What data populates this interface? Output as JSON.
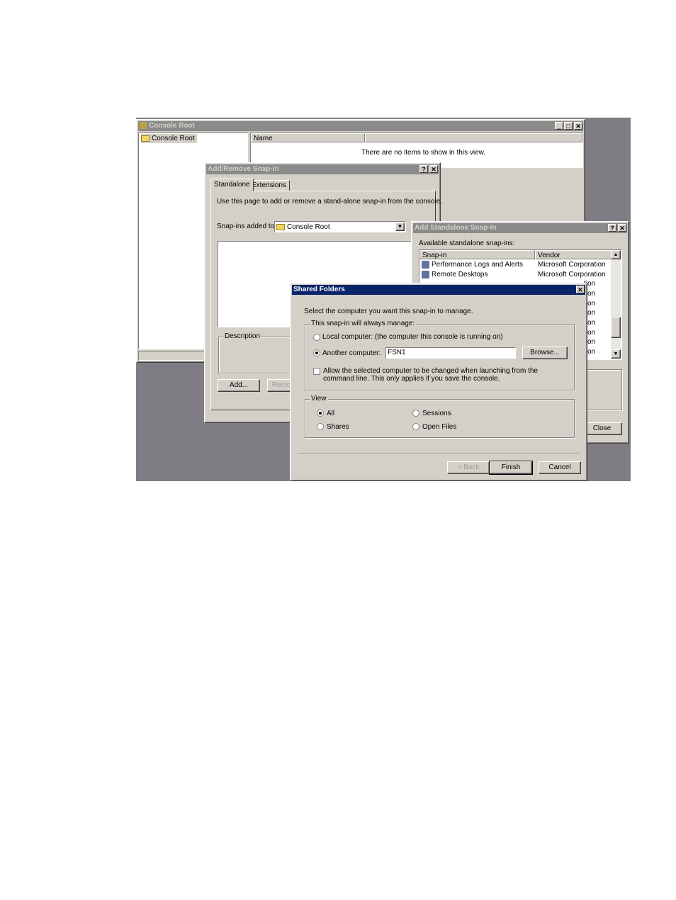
{
  "console": {
    "title": "Console Root",
    "tree_item": "Console Root",
    "column_name": "Name",
    "empty_message": "There are no items to show in this view."
  },
  "add_remove": {
    "title": "Add/Remove Snap-in",
    "tab_standalone": "Standalone",
    "tab_extensions": "Extensions",
    "instruction": "Use this page to add or remove a stand-alone snap-in from the console.",
    "added_to_label": "Snap-ins added to:",
    "added_to_value": "Console Root",
    "description_label": "Description",
    "add_button": "Add...",
    "remove_button": "Remo"
  },
  "add_standalone": {
    "title": "Add Standalone Snap-in",
    "available_label": "Available standalone snap-ins:",
    "col_snapin": "Snap-in",
    "col_vendor": "Vendor",
    "rows": [
      {
        "name": "Performance Logs and Alerts",
        "vendor": "Microsoft Corporation"
      },
      {
        "name": "Remote Desktops",
        "vendor": "Microsoft Corporation"
      }
    ],
    "partial_vendor": "tion",
    "close_button": "Close"
  },
  "shared_folders": {
    "title": "Shared Folders",
    "prompt": "Select the computer you want this snap-in to manage.",
    "group_manage": "This snap-in will always manage:",
    "local_label": "Local computer:  (the computer this console is running on)",
    "another_label": "Another computer:",
    "computer_value": "FSN1",
    "browse_button": "Browse...",
    "allow_text": "Allow the selected computer to be changed when launching from the command line.  This only applies if you save the console.",
    "view_group": "View",
    "view_all": "All",
    "view_shares": "Shares",
    "view_sessions": "Sessions",
    "view_open_files": "Open Files",
    "back_button": "< Back",
    "finish_button": "Finish",
    "cancel_button": "Cancel",
    "selected_target": "another",
    "selected_view": "all"
  }
}
